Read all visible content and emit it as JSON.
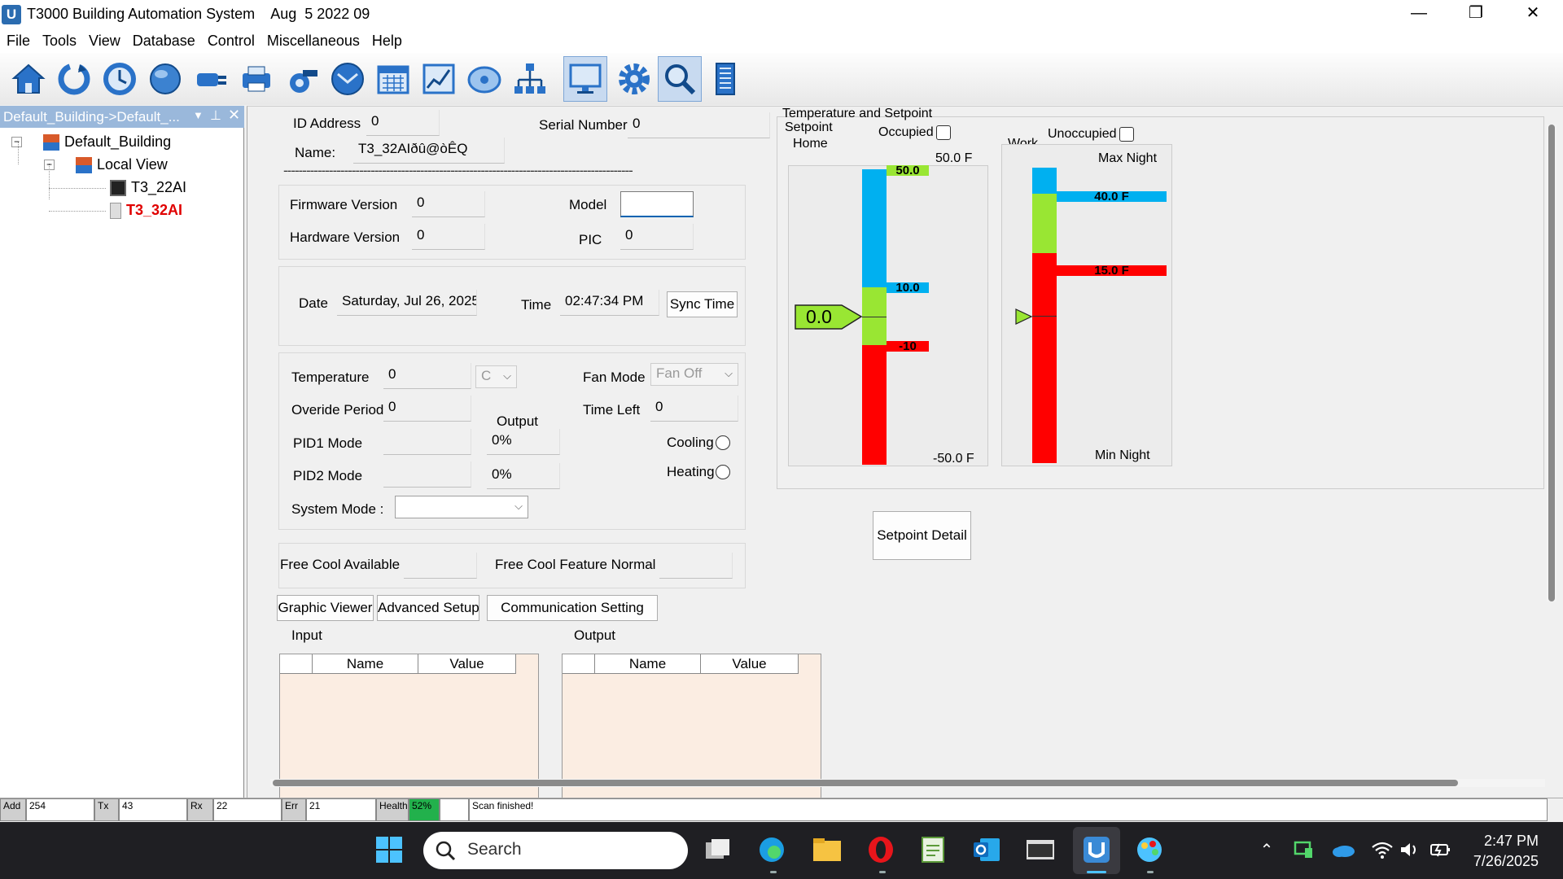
{
  "window": {
    "title": "T3000 Building Automation System",
    "build_date": "Aug  5 2022 09",
    "app_icon_letter": "U",
    "min_glyph": "—",
    "restore_glyph": "❐",
    "close_glyph": "✕"
  },
  "menu": [
    "File",
    "Tools",
    "View",
    "Database",
    "Control",
    "Miscellaneous",
    "Help"
  ],
  "toolbar": [
    "home-icon",
    "refresh-icon",
    "schedule-icon",
    "globe-icon",
    "plug-icon",
    "printer-icon",
    "camera-icon",
    "mail-icon",
    "calendar-icon",
    "trend-chart-icon",
    "disc-icon",
    "network-icon",
    "monitor-icon",
    "gear-icon",
    "magnifier-icon",
    "building-icon"
  ],
  "tree": {
    "header": "Default_Building->Default_...",
    "building": "Default_Building",
    "view": "Local View",
    "device1": "T3_22AI",
    "device2": "T3_32AI"
  },
  "device": {
    "id_label": "ID Address",
    "id_value": "0",
    "serial_label": "Serial Number",
    "serial_value": "0",
    "name_label": "Name:",
    "name_value": "T3_32AIðû@òÊQ",
    "separator": "--------------------------------------------------------------------------------------------",
    "firmware_label": "Firmware Version",
    "firmware_value": "0",
    "hardware_label": "Hardware Version",
    "hardware_value": "0",
    "model_label": "Model",
    "model_value": "",
    "pic_label": "PIC",
    "pic_value": "0",
    "date_label": "Date",
    "date_value": "Saturday, Jul 26, 2025",
    "time_label": "Time",
    "time_value": "02:47:34 PM",
    "sync_label": "Sync Time"
  },
  "control": {
    "temp_label": "Temperature",
    "temp_value": "0",
    "temp_unit": "C",
    "fan_label": "Fan Mode",
    "fan_value": "Fan Off",
    "override_label": "Overide Period",
    "override_value": "0",
    "output_label": "Output",
    "time_left_label": "Time Left",
    "time_left_value": "0",
    "pid1_label": "PID1 Mode",
    "pid1_value": "",
    "pid1_output": "0%",
    "pid2_label": "PID2 Mode",
    "pid2_value": "",
    "pid2_output": "0%",
    "cooling_label": "Cooling",
    "heating_label": "Heating",
    "system_mode_label": "System Mode :",
    "system_mode_value": ""
  },
  "freecool": {
    "available_label": "Free Cool Available",
    "available_value": "",
    "normal_label": "Free Cool Feature Normal",
    "normal_value": ""
  },
  "buttons": {
    "graphic": "Graphic Viewer",
    "advanced": "Advanced Setup",
    "comm": "Communication Setting",
    "setpoint_detail": "Setpoint Detail"
  },
  "tables": {
    "input_label": "Input",
    "output_label": "Output",
    "col_name": "Name",
    "col_value": "Value"
  },
  "setpoint": {
    "group_title": "Temperature and Setpoint",
    "setpoint_label": "Setpoint",
    "occupied_label": "Occupied",
    "unoccupied_label": "Unoccupied",
    "home": {
      "label": "Home",
      "max_label": "50.0 F",
      "min_label": "-50.0 F",
      "top_marker": "50.0",
      "mid_marker": "10.0",
      "low_marker": "-10",
      "current": "0.0"
    },
    "work": {
      "label": "Work",
      "max_label": "Max Night",
      "min_label": "Min Night",
      "high_marker": "40.0 F",
      "low_marker": "15.0 F"
    },
    "colors": {
      "cool": "#00b0f0",
      "comfort": "#99e633",
      "heat": "#ff0000"
    }
  },
  "status": {
    "add_label": "Add",
    "add_value": "254",
    "tx_label": "Tx",
    "tx_value": "43",
    "rx_label": "Rx",
    "rx_value": "22",
    "err_label": "Err",
    "err_value": "21",
    "health_label": "Health",
    "health_value": "52%",
    "message": "Scan finished!"
  },
  "taskbar": {
    "search": "Search",
    "time": "2:47 PM",
    "date": "7/26/2025"
  }
}
